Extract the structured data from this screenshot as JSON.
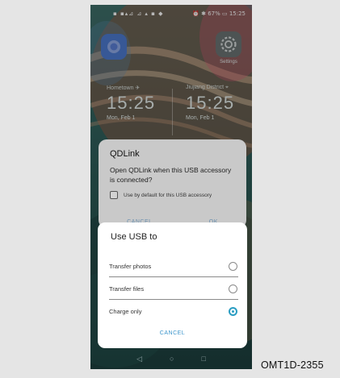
{
  "statusbar": {
    "left": "▪ ▪▴⊿ ⊿ ▴ ▪ ◆",
    "right": "⏰ ✱ 67% ▭ 15:25"
  },
  "apps": {
    "left_label": "",
    "right_label": "Settings"
  },
  "clocks": {
    "left": {
      "city": "Hometown ✈",
      "time": "15:25",
      "date": "Mon, Feb 1"
    },
    "right": {
      "city": "Jiujiang District ⌖",
      "time": "15:25",
      "date": "Mon, Feb 1"
    }
  },
  "dialog_qdlink": {
    "title": "QDLink",
    "body": "Open QDLink when this USB accessory is connected?",
    "checkbox_label": "Use by default for this USB accessory",
    "cancel_label": "CANCEL",
    "ok_label": "OK"
  },
  "dialog_usb": {
    "title": "Use USB to",
    "options": [
      {
        "label": "Transfer photos",
        "selected": false
      },
      {
        "label": "Transfer files",
        "selected": false
      },
      {
        "label": "Charge only",
        "selected": true
      }
    ],
    "cancel_label": "CANCEL"
  },
  "navbar": {
    "back": "◁",
    "home": "○",
    "recents": "□"
  },
  "caption": "OMT1D-2355",
  "colors": {
    "accent": "#2a9dc2",
    "dialog_link": "#3d96cc",
    "wallpaper_base": "#2e5e5a"
  }
}
